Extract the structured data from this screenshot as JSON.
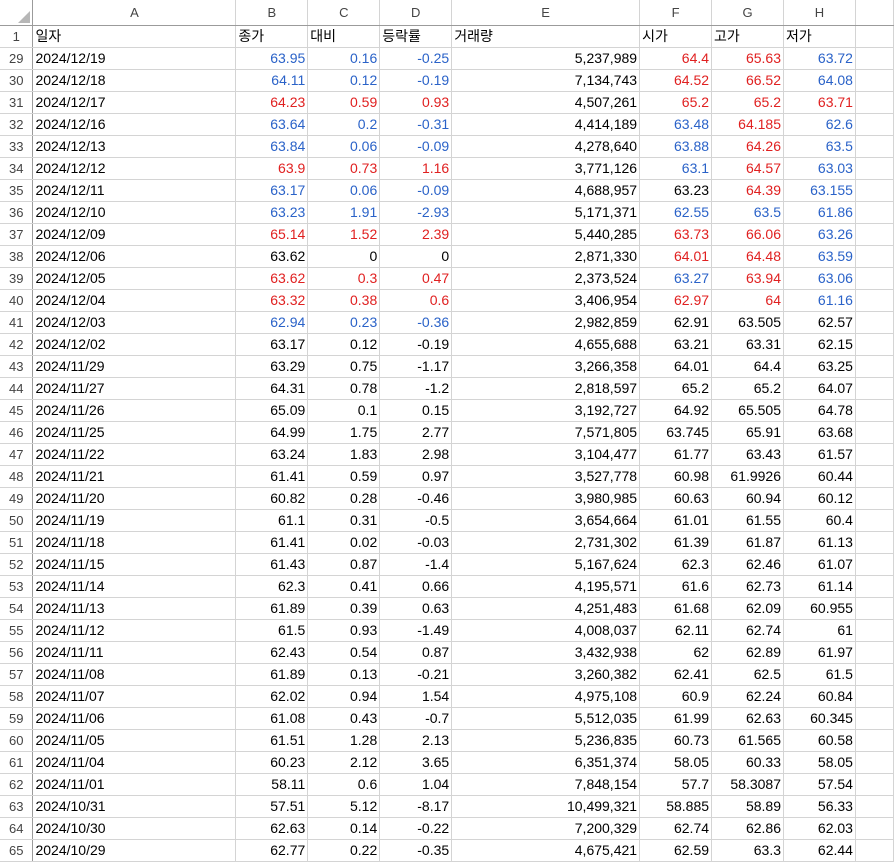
{
  "columns": [
    "A",
    "B",
    "C",
    "D",
    "E",
    "F",
    "G",
    "H"
  ],
  "header_row": {
    "num": "1",
    "cells": [
      "일자",
      "종가",
      "대비",
      "등락률",
      "거래량",
      "시가",
      "고가",
      "저가"
    ]
  },
  "rows": [
    {
      "num": "29",
      "cells": [
        "2024/12/19",
        "63.95",
        "0.16",
        "-0.25",
        "5,237,989",
        "64.4",
        "65.63",
        "63.72"
      ],
      "colors": [
        "",
        "blue",
        "blue",
        "blue",
        "",
        "red",
        "red",
        "blue"
      ]
    },
    {
      "num": "30",
      "cells": [
        "2024/12/18",
        "64.11",
        "0.12",
        "-0.19",
        "7,134,743",
        "64.52",
        "66.52",
        "64.08"
      ],
      "colors": [
        "",
        "blue",
        "blue",
        "blue",
        "",
        "red",
        "red",
        "blue"
      ]
    },
    {
      "num": "31",
      "cells": [
        "2024/12/17",
        "64.23",
        "0.59",
        "0.93",
        "4,507,261",
        "65.2",
        "65.2",
        "63.71"
      ],
      "colors": [
        "",
        "red",
        "red",
        "red",
        "",
        "red",
        "red",
        "red"
      ]
    },
    {
      "num": "32",
      "cells": [
        "2024/12/16",
        "63.64",
        "0.2",
        "-0.31",
        "4,414,189",
        "63.48",
        "64.185",
        "62.6"
      ],
      "colors": [
        "",
        "blue",
        "blue",
        "blue",
        "",
        "blue",
        "red",
        "blue"
      ]
    },
    {
      "num": "33",
      "cells": [
        "2024/12/13",
        "63.84",
        "0.06",
        "-0.09",
        "4,278,640",
        "63.88",
        "64.26",
        "63.5"
      ],
      "colors": [
        "",
        "blue",
        "blue",
        "blue",
        "",
        "blue",
        "red",
        "blue"
      ]
    },
    {
      "num": "34",
      "cells": [
        "2024/12/12",
        "63.9",
        "0.73",
        "1.16",
        "3,771,126",
        "63.1",
        "64.57",
        "63.03"
      ],
      "colors": [
        "",
        "red",
        "red",
        "red",
        "",
        "blue",
        "red",
        "blue"
      ]
    },
    {
      "num": "35",
      "cells": [
        "2024/12/11",
        "63.17",
        "0.06",
        "-0.09",
        "4,688,957",
        "63.23",
        "64.39",
        "63.155"
      ],
      "colors": [
        "",
        "blue",
        "blue",
        "blue",
        "",
        "",
        "red",
        "blue"
      ]
    },
    {
      "num": "36",
      "cells": [
        "2024/12/10",
        "63.23",
        "1.91",
        "-2.93",
        "5,171,371",
        "62.55",
        "63.5",
        "61.86"
      ],
      "colors": [
        "",
        "blue",
        "blue",
        "blue",
        "",
        "blue",
        "blue",
        "blue"
      ]
    },
    {
      "num": "37",
      "cells": [
        "2024/12/09",
        "65.14",
        "1.52",
        "2.39",
        "5,440,285",
        "63.73",
        "66.06",
        "63.26"
      ],
      "colors": [
        "",
        "red",
        "red",
        "red",
        "",
        "red",
        "red",
        "blue"
      ]
    },
    {
      "num": "38",
      "cells": [
        "2024/12/06",
        "63.62",
        "0",
        "0",
        "2,871,330",
        "64.01",
        "64.48",
        "63.59"
      ],
      "colors": [
        "",
        "",
        "",
        "",
        "",
        "red",
        "red",
        "blue"
      ]
    },
    {
      "num": "39",
      "cells": [
        "2024/12/05",
        "63.62",
        "0.3",
        "0.47",
        "2,373,524",
        "63.27",
        "63.94",
        "63.06"
      ],
      "colors": [
        "",
        "red",
        "red",
        "red",
        "",
        "blue",
        "red",
        "blue"
      ]
    },
    {
      "num": "40",
      "cells": [
        "2024/12/04",
        "63.32",
        "0.38",
        "0.6",
        "3,406,954",
        "62.97",
        "64",
        "61.16"
      ],
      "colors": [
        "",
        "red",
        "red",
        "red",
        "",
        "red",
        "red",
        "blue"
      ]
    },
    {
      "num": "41",
      "cells": [
        "2024/12/03",
        "62.94",
        "0.23",
        "-0.36",
        "2,982,859",
        "62.91",
        "63.505",
        "62.57"
      ],
      "colors": [
        "",
        "blue",
        "blue",
        "blue",
        "",
        "",
        "",
        ""
      ]
    },
    {
      "num": "42",
      "cells": [
        "2024/12/02",
        "63.17",
        "0.12",
        "-0.19",
        "4,655,688",
        "63.21",
        "63.31",
        "62.15"
      ],
      "colors": [
        "",
        "",
        "",
        "",
        "",
        "",
        "",
        ""
      ]
    },
    {
      "num": "43",
      "cells": [
        "2024/11/29",
        "63.29",
        "0.75",
        "-1.17",
        "3,266,358",
        "64.01",
        "64.4",
        "63.25"
      ],
      "colors": [
        "",
        "",
        "",
        "",
        "",
        "",
        "",
        ""
      ]
    },
    {
      "num": "44",
      "cells": [
        "2024/11/27",
        "64.31",
        "0.78",
        "-1.2",
        "2,818,597",
        "65.2",
        "65.2",
        "64.07"
      ],
      "colors": [
        "",
        "",
        "",
        "",
        "",
        "",
        "",
        ""
      ]
    },
    {
      "num": "45",
      "cells": [
        "2024/11/26",
        "65.09",
        "0.1",
        "0.15",
        "3,192,727",
        "64.92",
        "65.505",
        "64.78"
      ],
      "colors": [
        "",
        "",
        "",
        "",
        "",
        "",
        "",
        ""
      ]
    },
    {
      "num": "46",
      "cells": [
        "2024/11/25",
        "64.99",
        "1.75",
        "2.77",
        "7,571,805",
        "63.745",
        "65.91",
        "63.68"
      ],
      "colors": [
        "",
        "",
        "",
        "",
        "",
        "",
        "",
        ""
      ]
    },
    {
      "num": "47",
      "cells": [
        "2024/11/22",
        "63.24",
        "1.83",
        "2.98",
        "3,104,477",
        "61.77",
        "63.43",
        "61.57"
      ],
      "colors": [
        "",
        "",
        "",
        "",
        "",
        "",
        "",
        ""
      ]
    },
    {
      "num": "48",
      "cells": [
        "2024/11/21",
        "61.41",
        "0.59",
        "0.97",
        "3,527,778",
        "60.98",
        "61.9926",
        "60.44"
      ],
      "colors": [
        "",
        "",
        "",
        "",
        "",
        "",
        "",
        ""
      ]
    },
    {
      "num": "49",
      "cells": [
        "2024/11/20",
        "60.82",
        "0.28",
        "-0.46",
        "3,980,985",
        "60.63",
        "60.94",
        "60.12"
      ],
      "colors": [
        "",
        "",
        "",
        "",
        "",
        "",
        "",
        ""
      ]
    },
    {
      "num": "50",
      "cells": [
        "2024/11/19",
        "61.1",
        "0.31",
        "-0.5",
        "3,654,664",
        "61.01",
        "61.55",
        "60.4"
      ],
      "colors": [
        "",
        "",
        "",
        "",
        "",
        "",
        "",
        ""
      ]
    },
    {
      "num": "51",
      "cells": [
        "2024/11/18",
        "61.41",
        "0.02",
        "-0.03",
        "2,731,302",
        "61.39",
        "61.87",
        "61.13"
      ],
      "colors": [
        "",
        "",
        "",
        "",
        "",
        "",
        "",
        ""
      ]
    },
    {
      "num": "52",
      "cells": [
        "2024/11/15",
        "61.43",
        "0.87",
        "-1.4",
        "5,167,624",
        "62.3",
        "62.46",
        "61.07"
      ],
      "colors": [
        "",
        "",
        "",
        "",
        "",
        "",
        "",
        ""
      ]
    },
    {
      "num": "53",
      "cells": [
        "2024/11/14",
        "62.3",
        "0.41",
        "0.66",
        "4,195,571",
        "61.6",
        "62.73",
        "61.14"
      ],
      "colors": [
        "",
        "",
        "",
        "",
        "",
        "",
        "",
        ""
      ]
    },
    {
      "num": "54",
      "cells": [
        "2024/11/13",
        "61.89",
        "0.39",
        "0.63",
        "4,251,483",
        "61.68",
        "62.09",
        "60.955"
      ],
      "colors": [
        "",
        "",
        "",
        "",
        "",
        "",
        "",
        ""
      ]
    },
    {
      "num": "55",
      "cells": [
        "2024/11/12",
        "61.5",
        "0.93",
        "-1.49",
        "4,008,037",
        "62.11",
        "62.74",
        "61"
      ],
      "colors": [
        "",
        "",
        "",
        "",
        "",
        "",
        "",
        ""
      ]
    },
    {
      "num": "56",
      "cells": [
        "2024/11/11",
        "62.43",
        "0.54",
        "0.87",
        "3,432,938",
        "62",
        "62.89",
        "61.97"
      ],
      "colors": [
        "",
        "",
        "",
        "",
        "",
        "",
        "",
        ""
      ]
    },
    {
      "num": "57",
      "cells": [
        "2024/11/08",
        "61.89",
        "0.13",
        "-0.21",
        "3,260,382",
        "62.41",
        "62.5",
        "61.5"
      ],
      "colors": [
        "",
        "",
        "",
        "",
        "",
        "",
        "",
        ""
      ]
    },
    {
      "num": "58",
      "cells": [
        "2024/11/07",
        "62.02",
        "0.94",
        "1.54",
        "4,975,108",
        "60.9",
        "62.24",
        "60.84"
      ],
      "colors": [
        "",
        "",
        "",
        "",
        "",
        "",
        "",
        ""
      ]
    },
    {
      "num": "59",
      "cells": [
        "2024/11/06",
        "61.08",
        "0.43",
        "-0.7",
        "5,512,035",
        "61.99",
        "62.63",
        "60.345"
      ],
      "colors": [
        "",
        "",
        "",
        "",
        "",
        "",
        "",
        ""
      ]
    },
    {
      "num": "60",
      "cells": [
        "2024/11/05",
        "61.51",
        "1.28",
        "2.13",
        "5,236,835",
        "60.73",
        "61.565",
        "60.58"
      ],
      "colors": [
        "",
        "",
        "",
        "",
        "",
        "",
        "",
        ""
      ]
    },
    {
      "num": "61",
      "cells": [
        "2024/11/04",
        "60.23",
        "2.12",
        "3.65",
        "6,351,374",
        "58.05",
        "60.33",
        "58.05"
      ],
      "colors": [
        "",
        "",
        "",
        "",
        "",
        "",
        "",
        ""
      ]
    },
    {
      "num": "62",
      "cells": [
        "2024/11/01",
        "58.11",
        "0.6",
        "1.04",
        "7,848,154",
        "57.7",
        "58.3087",
        "57.54"
      ],
      "colors": [
        "",
        "",
        "",
        "",
        "",
        "",
        "",
        ""
      ]
    },
    {
      "num": "63",
      "cells": [
        "2024/10/31",
        "57.51",
        "5.12",
        "-8.17",
        "10,499,321",
        "58.885",
        "58.89",
        "56.33"
      ],
      "colors": [
        "",
        "",
        "",
        "",
        "",
        "",
        "",
        ""
      ]
    },
    {
      "num": "64",
      "cells": [
        "2024/10/30",
        "62.63",
        "0.14",
        "-0.22",
        "7,200,329",
        "62.74",
        "62.86",
        "62.03"
      ],
      "colors": [
        "",
        "",
        "",
        "",
        "",
        "",
        "",
        ""
      ]
    },
    {
      "num": "65",
      "cells": [
        "2024/10/29",
        "62.77",
        "0.22",
        "-0.35",
        "4,675,421",
        "62.59",
        "63.3",
        "62.44"
      ],
      "colors": [
        "",
        "",
        "",
        "",
        "",
        "",
        "",
        ""
      ]
    }
  ],
  "colors": {
    "up": "#e02020",
    "down": "#2a62c8",
    "grid": "#d4d4d4"
  }
}
